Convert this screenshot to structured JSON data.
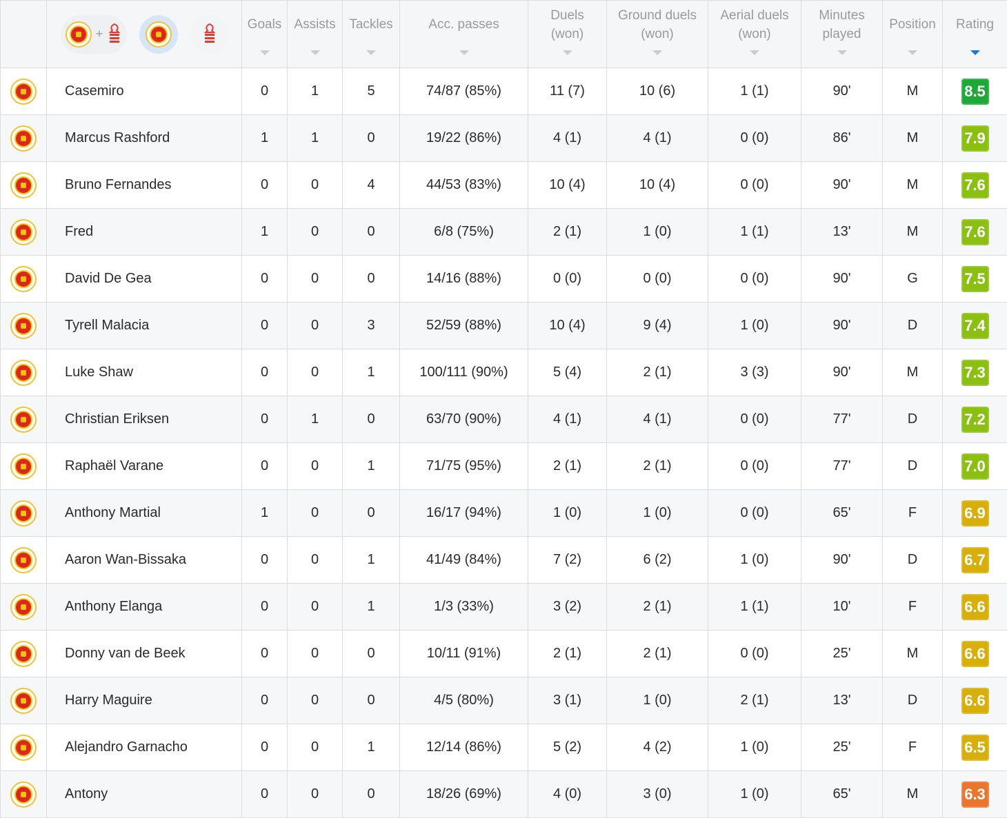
{
  "filter": {
    "both_icons": [
      "man-utd-crest-icon",
      "nottingham-forest-crest-icon"
    ],
    "plus": "+",
    "selected": "team-a",
    "team_a_icon": "man-utd-crest-icon",
    "team_b_icon": "nottingham-forest-crest-icon"
  },
  "columns": [
    {
      "key": "goals",
      "line1": "Goals",
      "line2": ""
    },
    {
      "key": "assists",
      "line1": "Assists",
      "line2": ""
    },
    {
      "key": "tackles",
      "line1": "Tackles",
      "line2": ""
    },
    {
      "key": "passes",
      "line1": "Acc. passes",
      "line2": ""
    },
    {
      "key": "duels",
      "line1": "Duels",
      "line2": "(won)"
    },
    {
      "key": "ground",
      "line1": "Ground duels",
      "line2": "(won)"
    },
    {
      "key": "aerial",
      "line1": "Aerial duels",
      "line2": "(won)"
    },
    {
      "key": "minutes",
      "line1": "Minutes",
      "line2": "played"
    },
    {
      "key": "position",
      "line1": "Position",
      "line2": ""
    },
    {
      "key": "rating",
      "line1": "Rating",
      "line2": ""
    }
  ],
  "sort_column": "rating",
  "rating_colors": {
    "excellent": "#1ea838",
    "verygood": "#8bbf12",
    "good": "#d8ae0a",
    "average": "#e8762d"
  },
  "players": [
    {
      "name": "Casemiro",
      "goals": "0",
      "assists": "1",
      "tackles": "5",
      "passes": "74/87 (85%)",
      "duels": "11 (7)",
      "ground": "10 (6)",
      "aerial": "1 (1)",
      "minutes": "90'",
      "position": "M",
      "rating": "8.5",
      "tier": "excellent"
    },
    {
      "name": "Marcus Rashford",
      "goals": "1",
      "assists": "1",
      "tackles": "0",
      "passes": "19/22 (86%)",
      "duels": "4 (1)",
      "ground": "4 (1)",
      "aerial": "0 (0)",
      "minutes": "86'",
      "position": "M",
      "rating": "7.9",
      "tier": "verygood"
    },
    {
      "name": "Bruno Fernandes",
      "goals": "0",
      "assists": "0",
      "tackles": "4",
      "passes": "44/53 (83%)",
      "duels": "10 (4)",
      "ground": "10 (4)",
      "aerial": "0 (0)",
      "minutes": "90'",
      "position": "M",
      "rating": "7.6",
      "tier": "verygood"
    },
    {
      "name": "Fred",
      "goals": "1",
      "assists": "0",
      "tackles": "0",
      "passes": "6/8 (75%)",
      "duels": "2 (1)",
      "ground": "1 (0)",
      "aerial": "1 (1)",
      "minutes": "13'",
      "position": "M",
      "rating": "7.6",
      "tier": "verygood"
    },
    {
      "name": "David De Gea",
      "goals": "0",
      "assists": "0",
      "tackles": "0",
      "passes": "14/16 (88%)",
      "duels": "0 (0)",
      "ground": "0 (0)",
      "aerial": "0 (0)",
      "minutes": "90'",
      "position": "G",
      "rating": "7.5",
      "tier": "verygood"
    },
    {
      "name": "Tyrell Malacia",
      "goals": "0",
      "assists": "0",
      "tackles": "3",
      "passes": "52/59 (88%)",
      "duels": "10 (4)",
      "ground": "9 (4)",
      "aerial": "1 (0)",
      "minutes": "90'",
      "position": "D",
      "rating": "7.4",
      "tier": "verygood"
    },
    {
      "name": "Luke Shaw",
      "goals": "0",
      "assists": "0",
      "tackles": "1",
      "passes": "100/111 (90%)",
      "duels": "5 (4)",
      "ground": "2 (1)",
      "aerial": "3 (3)",
      "minutes": "90'",
      "position": "M",
      "rating": "7.3",
      "tier": "verygood"
    },
    {
      "name": "Christian Eriksen",
      "goals": "0",
      "assists": "1",
      "tackles": "0",
      "passes": "63/70 (90%)",
      "duels": "4 (1)",
      "ground": "4 (1)",
      "aerial": "0 (0)",
      "minutes": "77'",
      "position": "D",
      "rating": "7.2",
      "tier": "verygood"
    },
    {
      "name": "Raphaël Varane",
      "goals": "0",
      "assists": "0",
      "tackles": "1",
      "passes": "71/75 (95%)",
      "duels": "2 (1)",
      "ground": "2 (1)",
      "aerial": "0 (0)",
      "minutes": "77'",
      "position": "D",
      "rating": "7.0",
      "tier": "verygood"
    },
    {
      "name": "Anthony Martial",
      "goals": "1",
      "assists": "0",
      "tackles": "0",
      "passes": "16/17 (94%)",
      "duels": "1 (0)",
      "ground": "1 (0)",
      "aerial": "0 (0)",
      "minutes": "65'",
      "position": "F",
      "rating": "6.9",
      "tier": "good"
    },
    {
      "name": "Aaron Wan-Bissaka",
      "goals": "0",
      "assists": "0",
      "tackles": "1",
      "passes": "41/49 (84%)",
      "duels": "7 (2)",
      "ground": "6 (2)",
      "aerial": "1 (0)",
      "minutes": "90'",
      "position": "D",
      "rating": "6.7",
      "tier": "good"
    },
    {
      "name": "Anthony Elanga",
      "goals": "0",
      "assists": "0",
      "tackles": "1",
      "passes": "1/3 (33%)",
      "duels": "3 (2)",
      "ground": "2 (1)",
      "aerial": "1 (1)",
      "minutes": "10'",
      "position": "F",
      "rating": "6.6",
      "tier": "good"
    },
    {
      "name": "Donny van de Beek",
      "goals": "0",
      "assists": "0",
      "tackles": "0",
      "passes": "10/11 (91%)",
      "duels": "2 (1)",
      "ground": "2 (1)",
      "aerial": "0 (0)",
      "minutes": "25'",
      "position": "M",
      "rating": "6.6",
      "tier": "good"
    },
    {
      "name": "Harry Maguire",
      "goals": "0",
      "assists": "0",
      "tackles": "0",
      "passes": "4/5 (80%)",
      "duels": "3 (1)",
      "ground": "1 (0)",
      "aerial": "2 (1)",
      "minutes": "13'",
      "position": "D",
      "rating": "6.6",
      "tier": "good"
    },
    {
      "name": "Alejandro Garnacho",
      "goals": "0",
      "assists": "0",
      "tackles": "1",
      "passes": "12/14 (86%)",
      "duels": "5 (2)",
      "ground": "4 (2)",
      "aerial": "1 (0)",
      "minutes": "25'",
      "position": "F",
      "rating": "6.5",
      "tier": "good"
    },
    {
      "name": "Antony",
      "goals": "0",
      "assists": "0",
      "tackles": "0",
      "passes": "18/26 (69%)",
      "duels": "4 (0)",
      "ground": "3 (0)",
      "aerial": "1 (0)",
      "minutes": "65'",
      "position": "M",
      "rating": "6.3",
      "tier": "average"
    }
  ]
}
